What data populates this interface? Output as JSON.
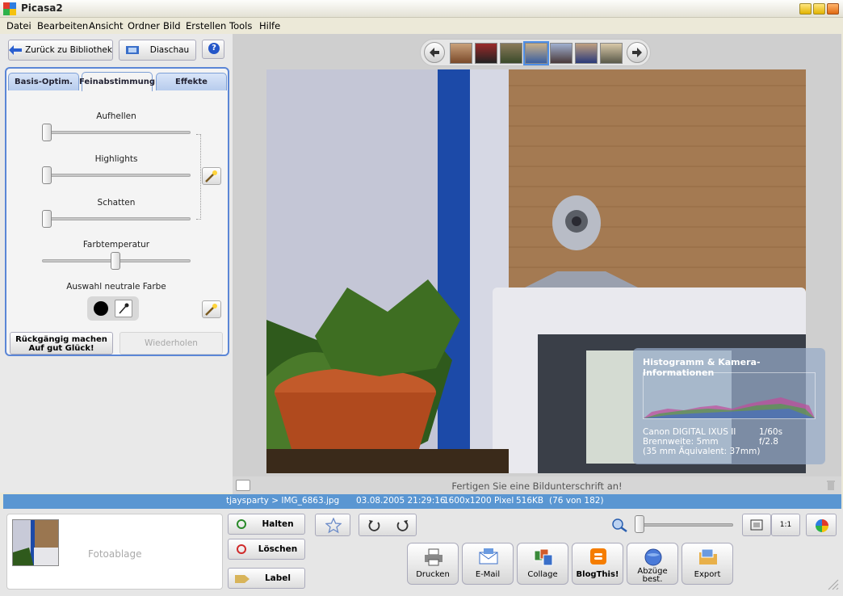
{
  "window": {
    "title": "Picasa2"
  },
  "menu": [
    "Datei",
    "Bearbeiten",
    "Ansicht",
    "Ordner",
    "Bild",
    "Erstellen",
    "Tools",
    "Hilfe"
  ],
  "toolbar": {
    "back_label": "Zurück zu Bibliothek",
    "slideshow_label": "Diaschau",
    "help_label": "?"
  },
  "tabs": [
    {
      "label": "Basis-Optim.",
      "active": false
    },
    {
      "label": "Feinabstimmung",
      "active": true
    },
    {
      "label": "Effekte",
      "active": false
    }
  ],
  "sliders": [
    {
      "label": "Aufhellen",
      "value": 0
    },
    {
      "label": "Highlights",
      "value": 0
    },
    {
      "label": "Schatten",
      "value": 0
    },
    {
      "label": "Farbtemperatur",
      "value": 0.5
    }
  ],
  "neutral_color": {
    "label": "Auswahl neutrale Farbe",
    "color": "#000000"
  },
  "undo": {
    "undo_label": "Rückgängig machen Auf gut Glück!",
    "redo_label": "Wiederholen"
  },
  "histogram": {
    "title": "Histogramm & Kamera-Informationen",
    "camera": "Canon DIGITAL IXUS II",
    "exposure": "1/60s",
    "focal": "Brennweite:   5mm",
    "aperture": "f/2.8",
    "equiv": "(35 mm Äquivalent:  37mm)"
  },
  "caption": {
    "placeholder": "Fertigen Sie eine Bildunterschrift an!"
  },
  "status": {
    "path": "tjaysparty > IMG_6863.jpg",
    "datetime": "03.08.2005 21:29:16",
    "resolution": "1600x1200 Pixel",
    "filesize": "516KB",
    "position": "(76 von 182)"
  },
  "tray": {
    "label": "Fotoablage"
  },
  "tray_buttons": {
    "hold": "Halten",
    "delete": "Löschen",
    "label": "Label"
  },
  "zoom": {
    "level": 0,
    "one_to_one": "1:1"
  },
  "actions": [
    {
      "label": "Drucken"
    },
    {
      "label": "E-Mail"
    },
    {
      "label": "Collage"
    },
    {
      "label": "BlogThis!"
    },
    {
      "label": "Abzüge best."
    },
    {
      "label": "Export"
    }
  ],
  "colors": {
    "accent": "#5a96d2",
    "tab_border": "#5b86d6"
  }
}
